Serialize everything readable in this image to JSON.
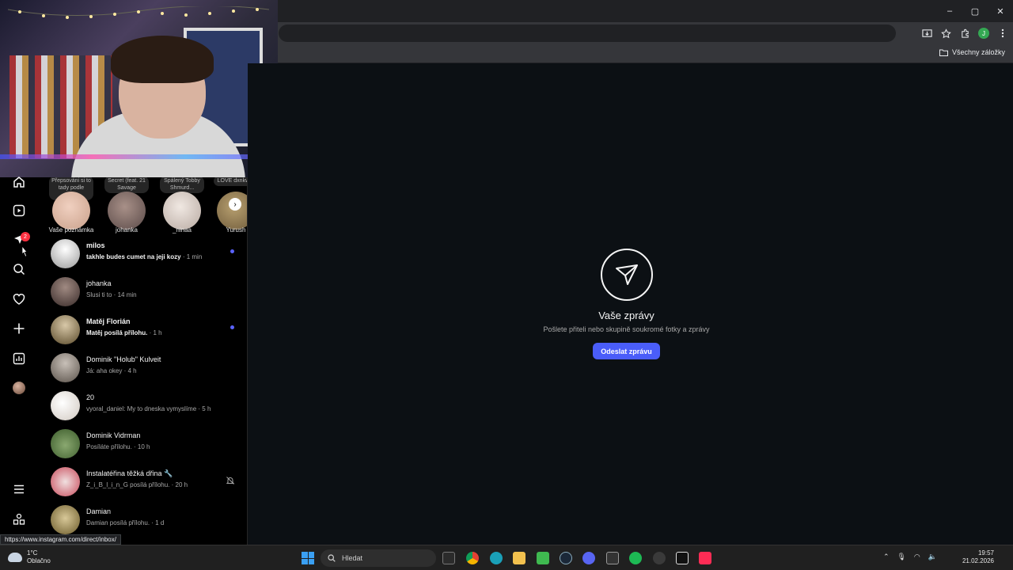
{
  "browser": {
    "window_controls": [
      "–",
      "▢",
      "✕"
    ],
    "bookmarks_all": "Všechny záložky",
    "profile_letter": "J",
    "status_url": "https://www.instagram.com/direct/inbox/"
  },
  "nav": {
    "badge": "2"
  },
  "notes": [
    {
      "bubble": "Přepsováni si to tady podle sebe...",
      "name": "Vaše poznámka",
      "color": "#c9a08a"
    },
    {
      "bubble": "Secret (feat. 21 Savage",
      "name": "johanka",
      "color": "#5a4a48"
    },
    {
      "bubble": "Spálený Tobby Shmurd...",
      "name": "_ninaa",
      "color": "#d9cfc8"
    },
    {
      "bubble": "LOVE dxnkwer",
      "name": "Yurush",
      "color": "#6e5a3a"
    }
  ],
  "threads": [
    {
      "name": "milos",
      "bold": true,
      "sub_bold": "takhle budes cumet na jeji kozy",
      "sub_time": " · 1 min",
      "unread": true,
      "muted": false,
      "color": "#e8e8e8"
    },
    {
      "name": "johanka",
      "bold": false,
      "sub_bold": "",
      "sub_time": "Slusi ti to · 14 min",
      "unread": false,
      "muted": false,
      "color": "#5a4a48"
    },
    {
      "name": "Matěj Florián",
      "bold": true,
      "sub_bold": "Matěj posílá přílohu.",
      "sub_time": " · 1 h",
      "unread": true,
      "muted": false,
      "color": "#8a7a5a"
    },
    {
      "name": "Dominik \"Holub\" Kulveit",
      "bold": false,
      "sub_bold": "",
      "sub_time": "Já: aha okey · 4 h",
      "unread": false,
      "muted": false,
      "color": "#9a8a7a"
    },
    {
      "name": "20",
      "bold": false,
      "sub_bold": "",
      "sub_time": "vyoral_daniel: My to dneska vymyslíme · 5 h",
      "unread": false,
      "muted": false,
      "color": "#f0f0f0"
    },
    {
      "name": "Dominik Vidrman",
      "bold": false,
      "sub_bold": "",
      "sub_time": "Posíláte přílohu. · 10 h",
      "unread": false,
      "muted": false,
      "color": "#4a6a3a"
    },
    {
      "name": "Instalatéřina těžká dřina 🔧",
      "bold": false,
      "sub_bold": "",
      "sub_time": "Z_i_B_l_i_n_G posílá přílohu. · 20 h",
      "unread": false,
      "muted": true,
      "color": "#c84a5a"
    },
    {
      "name": "Damian",
      "bold": false,
      "sub_bold": "",
      "sub_time": "Damian posílá přílohu. · 1 d",
      "unread": false,
      "muted": false,
      "color": "#8a7a3a"
    }
  ],
  "main": {
    "title": "Vaše zprávy",
    "subtitle": "Pošlete přiteli nebo skupině soukromé fotky a zprávy",
    "button": "Odeslat zprávu"
  },
  "taskbar": {
    "temp": "1°C",
    "weather": "Oblačno",
    "search_placeholder": "Hledat",
    "time": "19:57",
    "date": "21.02.2026",
    "apps": [
      {
        "name": "file-explorer",
        "color": "#2b2b2b"
      },
      {
        "name": "chrome",
        "color": "#e34133"
      },
      {
        "name": "edge",
        "color": "#1aa0b8"
      },
      {
        "name": "folders",
        "color": "#f2c14e"
      },
      {
        "name": "notes",
        "color": "#3fb950"
      },
      {
        "name": "steam",
        "color": "#1b2838"
      },
      {
        "name": "discord",
        "color": "#5865f2"
      },
      {
        "name": "epic-games",
        "color": "#333333"
      },
      {
        "name": "spotify",
        "color": "#1db954"
      },
      {
        "name": "obs",
        "color": "#3a3a3a"
      },
      {
        "name": "capcut",
        "color": "#111111"
      },
      {
        "name": "tiktok",
        "color": "#fe2c55"
      }
    ]
  }
}
